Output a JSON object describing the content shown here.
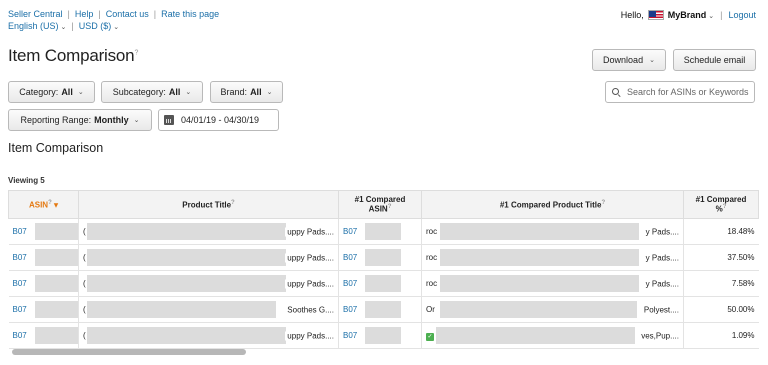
{
  "toplinks": {
    "seller_central": "Seller Central",
    "help": "Help",
    "contact": "Contact us",
    "rate": "Rate this page",
    "language": "English (US)",
    "currency": "USD ($)"
  },
  "user": {
    "hello": "Hello,",
    "brand": "MyBrand",
    "logout": "Logout"
  },
  "page_title": "Item Comparison",
  "buttons": {
    "download": "Download",
    "schedule": "Schedule email"
  },
  "filters": {
    "category_label": "Category:",
    "category_value": "All",
    "subcategory_label": "Subcategory:",
    "subcategory_value": "All",
    "brand_label": "Brand:",
    "brand_value": "All",
    "range_label": "Reporting Range:",
    "range_value": "Monthly",
    "dates": "04/01/19 - 04/30/19"
  },
  "search": {
    "placeholder": "Search for ASINs or Keywords"
  },
  "section_title": "Item Comparison",
  "viewing": "Viewing 5",
  "table": {
    "headers": {
      "asin": "ASIN",
      "product_title": "Product Title",
      "compared_asin_1": "#1 Compared",
      "compared_asin_2": "ASIN",
      "compared_title": "#1 Compared Product Title",
      "compared_pct_1": "#1 Compared",
      "compared_pct_2": "%"
    },
    "rows": [
      {
        "asin": "B07",
        "title_lead": "(",
        "title_tail": "uppy Pads....",
        "cmp_asin": "B07",
        "cmp_lead": "roc",
        "cmp_tail": "y Pads....",
        "pct": "18.48%"
      },
      {
        "asin": "B07",
        "title_lead": "(",
        "title_tail": "uppy Pads....",
        "cmp_asin": "B07",
        "cmp_lead": "roc",
        "cmp_tail": "y Pads....",
        "pct": "37.50%"
      },
      {
        "asin": "B07",
        "title_lead": "(",
        "title_tail": "uppy Pads....",
        "cmp_asin": "B07",
        "cmp_lead": "roc",
        "cmp_tail": "y Pads....",
        "pct": "7.58%"
      },
      {
        "asin": "B07",
        "title_lead": "(",
        "title_tail": "Soothes G....",
        "cmp_asin": "B07",
        "cmp_lead": "Or",
        "cmp_tail": "Polyest....",
        "pct": "50.00%"
      },
      {
        "asin": "B07",
        "title_lead": "(",
        "title_tail": "uppy Pads....",
        "cmp_asin": "B07",
        "cmp_lead": "",
        "cmp_tail": "ves,Pup....",
        "pct": "1.09%"
      }
    ]
  }
}
